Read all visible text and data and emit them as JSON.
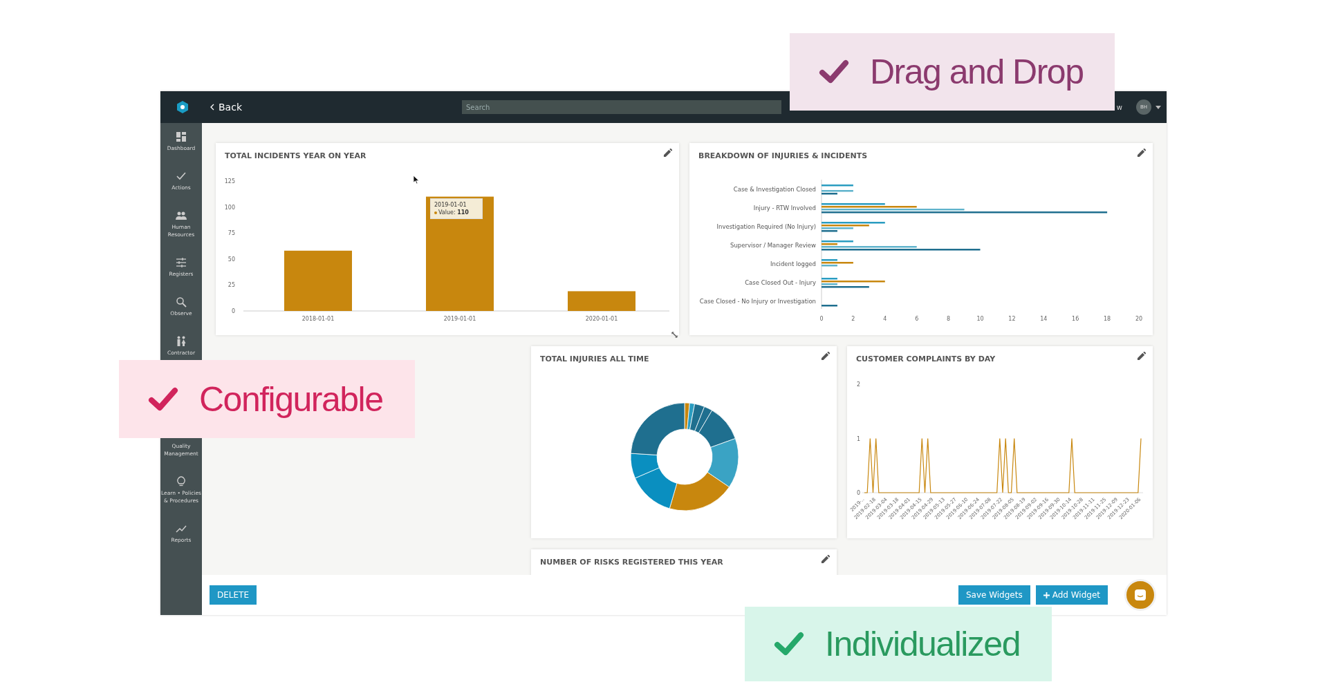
{
  "topbar": {
    "back": "Back",
    "search": {
      "placeholder": "Search"
    },
    "partial_text": "w",
    "avatar": "BH"
  },
  "sidebar": {
    "items": [
      {
        "label": "Dashboard"
      },
      {
        "label": "Actions"
      },
      {
        "label": "Human Resources"
      },
      {
        "label": "Registers"
      },
      {
        "label": "Observe"
      },
      {
        "label": "Contractor"
      },
      {
        "label": "Quality Management"
      },
      {
        "label": "Learn • Policies & Procedures"
      },
      {
        "label": "Reports"
      }
    ]
  },
  "widgets": [
    {
      "title": "TOTAL INCIDENTS YEAR ON YEAR",
      "tooltip": {
        "title": "2019-01-01",
        "text": "Value: **110**"
      },
      "chart_data": {
        "type": "bar",
        "categories": [
          "2018-01-01",
          "2019-01-01",
          "2020-01-01"
        ],
        "yticks": [
          0,
          25,
          50,
          75,
          100,
          125
        ],
        "ylim": [
          0,
          125
        ],
        "series": [
          {
            "color": "#c8870e",
            "values": [
              58,
              110,
              19
            ]
          }
        ]
      }
    },
    {
      "title": "BREAKDOWN OF INJURIES & INCIDENTS",
      "chart_data": {
        "type": "bar",
        "orientation": "horizontal",
        "categories": [
          "Case & Investigation Closed",
          "Injury - RTW Involved",
          "Investigation Required (No Injury)",
          "Supervisor / Manager Review",
          "Incident logged",
          "Case Closed Out - Injury",
          "Case Closed - No Injury or Investigation"
        ],
        "xticks": [
          0,
          2,
          4,
          6,
          8,
          10,
          12,
          14,
          16,
          18,
          20
        ],
        "xlim": [
          0,
          20
        ],
        "series": [
          {
            "color": "#2a9cc0",
            "values": [
              2,
              4,
              4,
              2,
              1,
              1,
              0
            ]
          },
          {
            "color": "#c8870e",
            "values": [
              0,
              6,
              3,
              1,
              2,
              4,
              0
            ]
          },
          {
            "color": "#5fb3cc",
            "values": [
              2,
              9,
              2,
              6,
              1,
              1,
              0
            ]
          },
          {
            "color": "#1f6f8f",
            "values": [
              1,
              18,
              1,
              10,
              0,
              3,
              1
            ]
          }
        ]
      }
    },
    {
      "title": "TOTAL INJURIES ALL TIME"
    },
    {
      "title": "CUSTOMER COMPLAINTS BY DAY",
      "chart_data": {
        "type": "line",
        "yticks": [
          0,
          1,
          2
        ],
        "ylim": [
          0,
          2
        ],
        "categories": [
          "2019-..",
          null,
          null,
          null,
          "2019-02-18",
          null,
          null,
          null,
          "2019-03-04",
          null,
          null,
          null,
          "2019-03-18",
          null,
          null,
          null,
          "2019-04-01",
          null,
          null,
          null,
          "2019-04-15",
          null,
          null,
          null,
          "2019-04-29",
          null,
          null,
          null,
          "2019-05-13",
          null,
          null,
          null,
          "2019-05-27",
          null,
          null,
          null,
          "2019-06-10",
          null,
          null,
          null,
          "2019-06-24",
          null,
          null,
          null,
          "2019-07-08",
          null,
          null,
          null,
          "2019-07-22",
          null,
          null,
          null,
          "2019-08-05",
          null,
          null,
          null,
          "2019-08-19",
          null,
          null,
          null,
          "2019-09-02",
          null,
          null,
          null,
          "2019-09-16",
          null,
          null,
          null,
          "2019-09-30",
          null,
          null,
          null,
          "2019-10-14",
          null,
          null,
          null,
          "2019-10-28",
          null,
          null,
          null,
          "2019-11-11",
          null,
          null,
          null,
          "2019-11-25",
          null,
          null,
          null,
          "2019-12-09",
          null,
          null,
          null,
          "2019-12-23",
          null,
          null,
          null,
          "2020-01-06"
        ],
        "series": [
          {
            "color": "#c8870e",
            "values": [
              0,
              0,
              1,
              0,
              1,
              0,
              0,
              0,
              0,
              0,
              0,
              0,
              0,
              0,
              0,
              0,
              0,
              0,
              0,
              0,
              1,
              0,
              1,
              0,
              0,
              0,
              0,
              0,
              0,
              0,
              0,
              0,
              0,
              0,
              0,
              0,
              0,
              0,
              0,
              0,
              0,
              0,
              0,
              0,
              0,
              0,
              0,
              1,
              0,
              1,
              0,
              0,
              1,
              0,
              0,
              0,
              0,
              0,
              0,
              0,
              0,
              0,
              0,
              0,
              0,
              0,
              0,
              0,
              0,
              0,
              0,
              0,
              1,
              0,
              0,
              0,
              0,
              0,
              0,
              0,
              0,
              0,
              0,
              0,
              0,
              0,
              0,
              0,
              0,
              0,
              0,
              0,
              0,
              0,
              0,
              0,
              1
            ]
          }
        ]
      }
    },
    {
      "title": "NUMBER OF RISKS REGISTERED THIS YEAR"
    }
  ],
  "actions": {
    "delete": "DELETE",
    "save": "Save Widgets",
    "add": "Add Widget"
  },
  "callouts": [
    {
      "text": "Drag and Drop",
      "color": "#8b3a6e"
    },
    {
      "text": "Configurable",
      "color": "#d1245c"
    },
    {
      "text": "Individualized",
      "color": "#2a9a5f"
    }
  ]
}
